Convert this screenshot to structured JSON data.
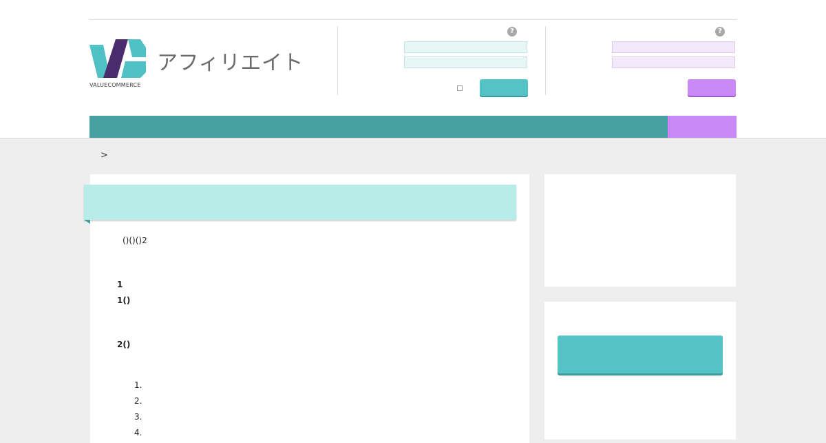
{
  "brand": {
    "logo_wordmark": "VALUECOMMERCE",
    "site_title": "アフィリエイト",
    "colors": {
      "teal": "#4fc0c3",
      "dark_purple": "#4a2b6b",
      "nav_teal": "#46a2a1",
      "accent_purple": "#c98af8",
      "ribbon_teal": "#b8ece9"
    }
  },
  "affiliate_login": {
    "help_icon": "question-icon",
    "id_value": "",
    "password_value": "",
    "remember_checked": false,
    "login_label": ""
  },
  "merchant_login": {
    "help_icon": "question-icon",
    "id_value": "",
    "password_value": "",
    "login_label": ""
  },
  "breadcrumb": {
    "separator": ">"
  },
  "main": {
    "heading": "",
    "intro": "()()()2",
    "section1_title": "1",
    "section1_sub": "1()",
    "section2_title": "2()",
    "list": [
      "1.",
      "2.",
      "3.",
      "4."
    ]
  },
  "sidebar": {
    "action_label": ""
  }
}
